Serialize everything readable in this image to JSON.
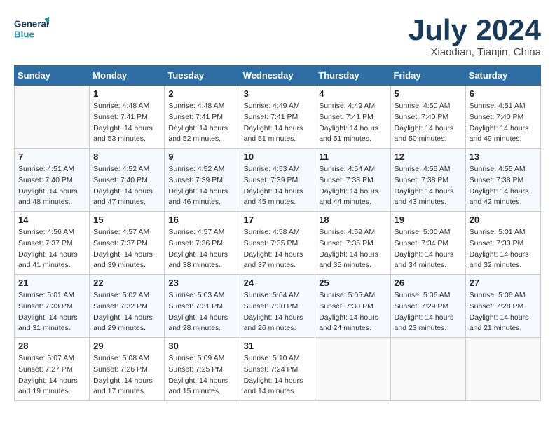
{
  "header": {
    "logo_line1": "General",
    "logo_line2": "Blue",
    "month_year": "July 2024",
    "location": "Xiaodian, Tianjin, China"
  },
  "weekdays": [
    "Sunday",
    "Monday",
    "Tuesday",
    "Wednesday",
    "Thursday",
    "Friday",
    "Saturday"
  ],
  "weeks": [
    [
      {
        "day": "",
        "info": ""
      },
      {
        "day": "1",
        "info": "Sunrise: 4:48 AM\nSunset: 7:41 PM\nDaylight: 14 hours\nand 53 minutes."
      },
      {
        "day": "2",
        "info": "Sunrise: 4:48 AM\nSunset: 7:41 PM\nDaylight: 14 hours\nand 52 minutes."
      },
      {
        "day": "3",
        "info": "Sunrise: 4:49 AM\nSunset: 7:41 PM\nDaylight: 14 hours\nand 51 minutes."
      },
      {
        "day": "4",
        "info": "Sunrise: 4:49 AM\nSunset: 7:41 PM\nDaylight: 14 hours\nand 51 minutes."
      },
      {
        "day": "5",
        "info": "Sunrise: 4:50 AM\nSunset: 7:40 PM\nDaylight: 14 hours\nand 50 minutes."
      },
      {
        "day": "6",
        "info": "Sunrise: 4:51 AM\nSunset: 7:40 PM\nDaylight: 14 hours\nand 49 minutes."
      }
    ],
    [
      {
        "day": "7",
        "info": "Sunrise: 4:51 AM\nSunset: 7:40 PM\nDaylight: 14 hours\nand 48 minutes."
      },
      {
        "day": "8",
        "info": "Sunrise: 4:52 AM\nSunset: 7:40 PM\nDaylight: 14 hours\nand 47 minutes."
      },
      {
        "day": "9",
        "info": "Sunrise: 4:52 AM\nSunset: 7:39 PM\nDaylight: 14 hours\nand 46 minutes."
      },
      {
        "day": "10",
        "info": "Sunrise: 4:53 AM\nSunset: 7:39 PM\nDaylight: 14 hours\nand 45 minutes."
      },
      {
        "day": "11",
        "info": "Sunrise: 4:54 AM\nSunset: 7:38 PM\nDaylight: 14 hours\nand 44 minutes."
      },
      {
        "day": "12",
        "info": "Sunrise: 4:55 AM\nSunset: 7:38 PM\nDaylight: 14 hours\nand 43 minutes."
      },
      {
        "day": "13",
        "info": "Sunrise: 4:55 AM\nSunset: 7:38 PM\nDaylight: 14 hours\nand 42 minutes."
      }
    ],
    [
      {
        "day": "14",
        "info": "Sunrise: 4:56 AM\nSunset: 7:37 PM\nDaylight: 14 hours\nand 41 minutes."
      },
      {
        "day": "15",
        "info": "Sunrise: 4:57 AM\nSunset: 7:37 PM\nDaylight: 14 hours\nand 39 minutes."
      },
      {
        "day": "16",
        "info": "Sunrise: 4:57 AM\nSunset: 7:36 PM\nDaylight: 14 hours\nand 38 minutes."
      },
      {
        "day": "17",
        "info": "Sunrise: 4:58 AM\nSunset: 7:35 PM\nDaylight: 14 hours\nand 37 minutes."
      },
      {
        "day": "18",
        "info": "Sunrise: 4:59 AM\nSunset: 7:35 PM\nDaylight: 14 hours\nand 35 minutes."
      },
      {
        "day": "19",
        "info": "Sunrise: 5:00 AM\nSunset: 7:34 PM\nDaylight: 14 hours\nand 34 minutes."
      },
      {
        "day": "20",
        "info": "Sunrise: 5:01 AM\nSunset: 7:33 PM\nDaylight: 14 hours\nand 32 minutes."
      }
    ],
    [
      {
        "day": "21",
        "info": "Sunrise: 5:01 AM\nSunset: 7:33 PM\nDaylight: 14 hours\nand 31 minutes."
      },
      {
        "day": "22",
        "info": "Sunrise: 5:02 AM\nSunset: 7:32 PM\nDaylight: 14 hours\nand 29 minutes."
      },
      {
        "day": "23",
        "info": "Sunrise: 5:03 AM\nSunset: 7:31 PM\nDaylight: 14 hours\nand 28 minutes."
      },
      {
        "day": "24",
        "info": "Sunrise: 5:04 AM\nSunset: 7:30 PM\nDaylight: 14 hours\nand 26 minutes."
      },
      {
        "day": "25",
        "info": "Sunrise: 5:05 AM\nSunset: 7:30 PM\nDaylight: 14 hours\nand 24 minutes."
      },
      {
        "day": "26",
        "info": "Sunrise: 5:06 AM\nSunset: 7:29 PM\nDaylight: 14 hours\nand 23 minutes."
      },
      {
        "day": "27",
        "info": "Sunrise: 5:06 AM\nSunset: 7:28 PM\nDaylight: 14 hours\nand 21 minutes."
      }
    ],
    [
      {
        "day": "28",
        "info": "Sunrise: 5:07 AM\nSunset: 7:27 PM\nDaylight: 14 hours\nand 19 minutes."
      },
      {
        "day": "29",
        "info": "Sunrise: 5:08 AM\nSunset: 7:26 PM\nDaylight: 14 hours\nand 17 minutes."
      },
      {
        "day": "30",
        "info": "Sunrise: 5:09 AM\nSunset: 7:25 PM\nDaylight: 14 hours\nand 15 minutes."
      },
      {
        "day": "31",
        "info": "Sunrise: 5:10 AM\nSunset: 7:24 PM\nDaylight: 14 hours\nand 14 minutes."
      },
      {
        "day": "",
        "info": ""
      },
      {
        "day": "",
        "info": ""
      },
      {
        "day": "",
        "info": ""
      }
    ]
  ]
}
